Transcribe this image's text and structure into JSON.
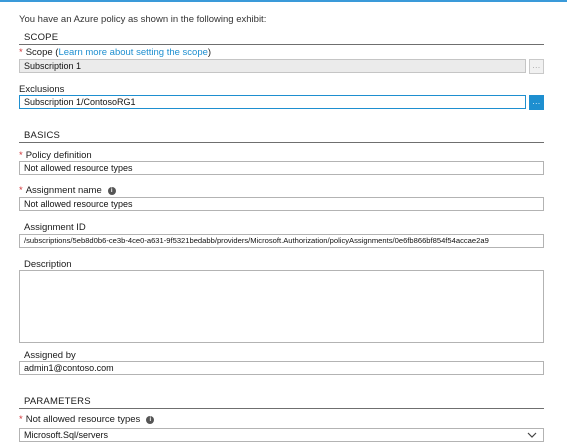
{
  "intro_text": "You have an Azure policy as shown in the following exhibit:",
  "scope_section": {
    "heading": "SCOPE",
    "scope_label": "Scope (",
    "scope_link": "Learn more about setting the scope",
    "scope_label_end": ")",
    "scope_value": "Subscription 1",
    "scope_button": "...",
    "exclusions_label": "Exclusions",
    "exclusions_value": "Subscription 1/ContosoRG1",
    "exclusions_button": "..."
  },
  "basics_section": {
    "heading": "BASICS",
    "policy_definition_label": "Policy definition",
    "policy_definition_value": "Not allowed resource types",
    "assignment_name_label": "Assignment name",
    "assignment_name_value": "Not allowed resource types",
    "assignment_id_label": "Assignment ID",
    "assignment_id_value": "/subscriptions/5eb8d0b6-ce3b-4ce0-a631-9f5321bedabb/providers/Microsoft.Authorization/policyAssignments/0e6fb866bf854f54accae2a9",
    "description_label": "Description",
    "description_value": "",
    "assigned_by_label": "Assigned by",
    "assigned_by_value": "admin1@contoso.com"
  },
  "parameters_section": {
    "heading": "PARAMETERS",
    "resource_types_label": "Not allowed resource types",
    "resource_types_value": "Microsoft.Sql/servers"
  },
  "symbols": {
    "required": "*",
    "info": "i"
  },
  "icons": {
    "info": "info-icon",
    "dropdown": "chevron-down-icon"
  },
  "colors": {
    "accent": "#1e8fd0",
    "required": "#d13438",
    "readonly_field": "#ebebeb"
  }
}
